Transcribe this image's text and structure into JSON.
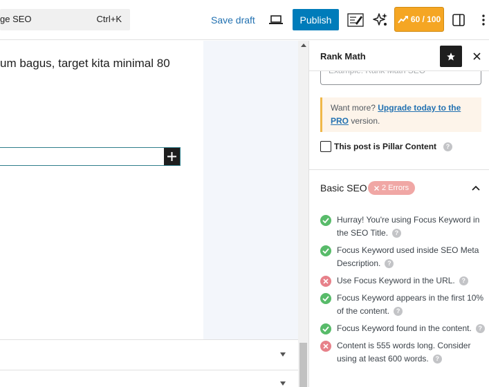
{
  "toolbar": {
    "command_text": "ge SEO",
    "command_shortcut": "Ctrl+K",
    "save_draft": "Save draft",
    "publish": "Publish",
    "score": "60 / 100"
  },
  "editor": {
    "paragraph_text": "um bagus, target kita minimal 80"
  },
  "colors": {
    "accent": "#007cba",
    "score_bg": "#f5a623",
    "success": "#58bb6a",
    "error": "#e7818a"
  },
  "sidebar": {
    "title": "Rank Math",
    "focus_keyword_placeholder": "Example: Rank Math SEO",
    "upsell": {
      "prefix": "Want more? ",
      "link": "Upgrade today to the PRO",
      "suffix": " version."
    },
    "pillar_label": "This post is Pillar Content",
    "basic_seo": {
      "title": "Basic SEO",
      "errors_badge": "2 Errors",
      "checks": [
        {
          "status": "ok",
          "text": "Hurray! You're using Focus Keyword in the SEO Title."
        },
        {
          "status": "ok",
          "text": "Focus Keyword used inside SEO Meta Description."
        },
        {
          "status": "error",
          "text": "Use Focus Keyword in the URL."
        },
        {
          "status": "ok",
          "text": "Focus Keyword appears in the first 10% of the content."
        },
        {
          "status": "ok",
          "text": "Focus Keyword found in the content."
        },
        {
          "status": "error",
          "text": "Content is 555 words long. Consider using at least 600 words."
        }
      ]
    }
  }
}
